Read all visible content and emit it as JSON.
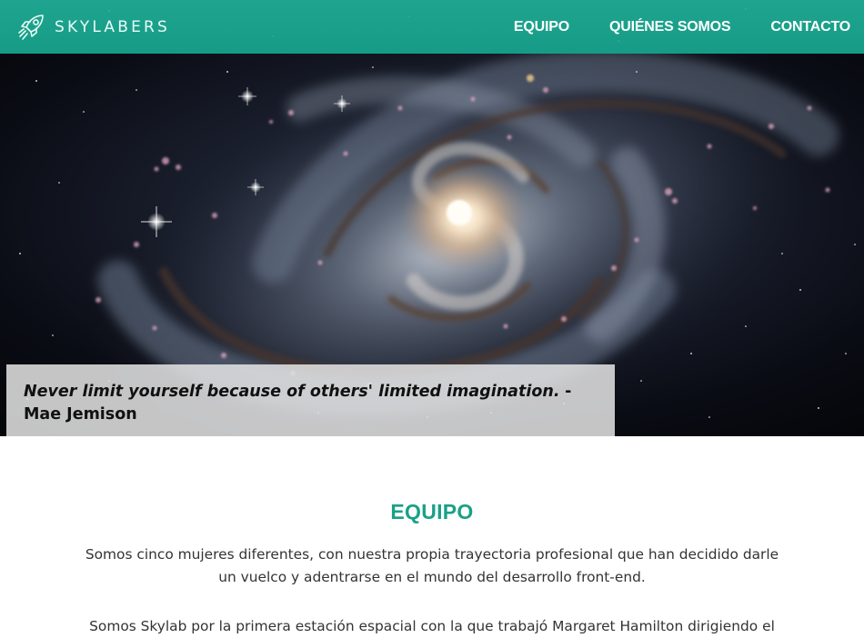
{
  "brand": {
    "name": "SKYLABERS",
    "logo_icon": "rocket-icon"
  },
  "nav": {
    "items": [
      {
        "label": "EQUIPO"
      },
      {
        "label": "QUIÉNES SOMOS"
      },
      {
        "label": "CONTACTO"
      }
    ]
  },
  "hero": {
    "image": "spiral-galaxy",
    "quote": {
      "text": "Never limit yourself because of others' limited imagination.",
      "author": "- Mae Jemison"
    }
  },
  "section": {
    "title": "EQUIPO",
    "paragraphs": [
      "Somos cinco mujeres diferentes, con nuestra propia trayectoria profesional que han decidido darle un vuelco y adentrarse en el mundo del desarrollo front-end.",
      "Somos Skylab por la primera estación espacial con la que trabajó Margaret Hamilton dirigiendo el"
    ]
  },
  "colors": {
    "accent": "#19a088",
    "navbar": "#1a9f89",
    "nav_text": "#ffffff",
    "quote_bg": "#e4e4e4",
    "body_text": "#333333"
  }
}
